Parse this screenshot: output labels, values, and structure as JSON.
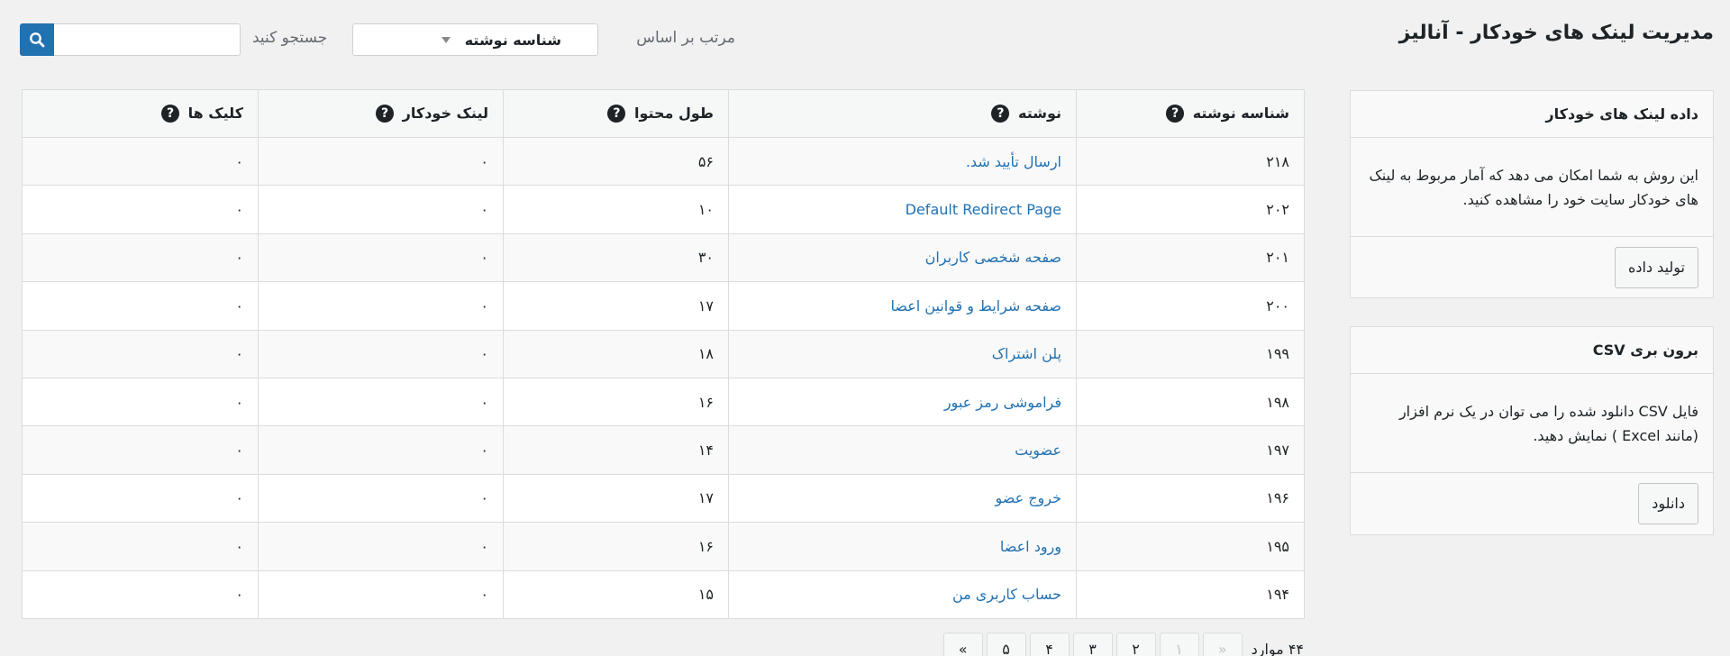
{
  "header": {
    "title": "مدیریت لینک های خودکار - آنالیز",
    "sort_label": "مرتب بر اساس",
    "sort_value": "شناسه نوشته",
    "search_label": "جستجو کنید",
    "search_value": "",
    "search_icon": "search-icon"
  },
  "sidebar": {
    "data_panel": {
      "title": "داده لینک های خودکار",
      "description": "این روش به شما امکان می دهد که آمار مربوط به لینک های خودکار سایت خود را مشاهده کنید.",
      "button_label": "تولید داده"
    },
    "csv_panel": {
      "title": "برون بری CSV",
      "description": "فایل CSV دانلود شده را می توان در یک نرم افزار (مانند Excel ) نمایش دهید.",
      "button_label": "دانلود"
    }
  },
  "table": {
    "columns": [
      "شناسه نوشته",
      "نوشته",
      "طول محتوا",
      "لینک خودکار",
      "کلیک ها"
    ],
    "help_glyph": "?",
    "rows": [
      {
        "id": "۲۱۸",
        "title": "ارسال تأیید شد.",
        "length": "۵۶",
        "autolinks": "۰",
        "clicks": "۰"
      },
      {
        "id": "۲۰۲",
        "title": "Default Redirect Page",
        "length": "۱۰",
        "autolinks": "۰",
        "clicks": "۰"
      },
      {
        "id": "۲۰۱",
        "title": "صفحه شخصی کاربران",
        "length": "۳۰",
        "autolinks": "۰",
        "clicks": "۰"
      },
      {
        "id": "۲۰۰",
        "title": "صفحه شرایط و قوانین اعضا",
        "length": "۱۷",
        "autolinks": "۰",
        "clicks": "۰"
      },
      {
        "id": "۱۹۹",
        "title": "پلن اشتراک",
        "length": "۱۸",
        "autolinks": "۰",
        "clicks": "۰"
      },
      {
        "id": "۱۹۸",
        "title": "فراموشی رمز عبور",
        "length": "۱۶",
        "autolinks": "۰",
        "clicks": "۰"
      },
      {
        "id": "۱۹۷",
        "title": "عضویت",
        "length": "۱۴",
        "autolinks": "۰",
        "clicks": "۰"
      },
      {
        "id": "۱۹۶",
        "title": "خروج عضو",
        "length": "۱۷",
        "autolinks": "۰",
        "clicks": "۰"
      },
      {
        "id": "۱۹۵",
        "title": "ورود اعضا",
        "length": "۱۶",
        "autolinks": "۰",
        "clicks": "۰"
      },
      {
        "id": "۱۹۴",
        "title": "حساب کاربری من",
        "length": "۱۵",
        "autolinks": "۰",
        "clicks": "۰"
      }
    ]
  },
  "pagination": {
    "items_count": "۴۴ موارد",
    "prev_label": "«",
    "pages": [
      "۱",
      "۲",
      "۳",
      "۴",
      "۵"
    ],
    "current_page": "۱",
    "next_label": "»"
  },
  "colors": {
    "accent": "#2271b1",
    "background": "#f1f1f1",
    "link": "#2271b1"
  }
}
